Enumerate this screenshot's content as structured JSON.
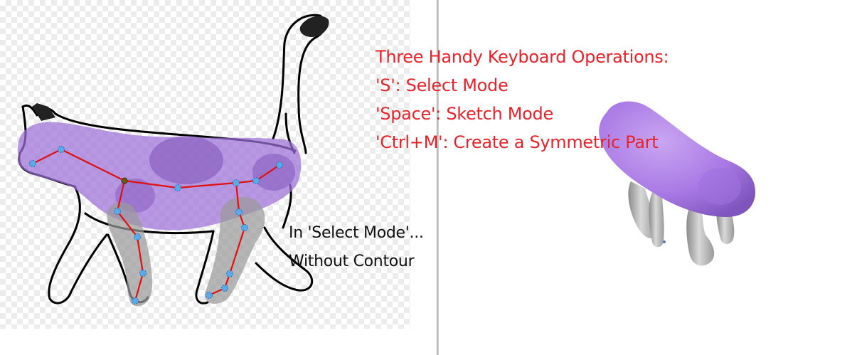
{
  "instructions": {
    "title": "Three Handy Keyboard Operations:",
    "items": [
      "'S': Select Mode",
      "'Space': Sketch Mode",
      "'Ctrl+M': Create a Symmetric Part"
    ]
  },
  "caption": {
    "line1": "In 'Select Mode'...",
    "line2": "Without Contour"
  },
  "colors": {
    "instruction_text": "#e8232b",
    "caption_text": "#111111",
    "body_fill": "#a67ee0",
    "leg_fill": "#aaaaaa",
    "skeleton_line": "#e01010",
    "joint": "#5aa9ea"
  }
}
